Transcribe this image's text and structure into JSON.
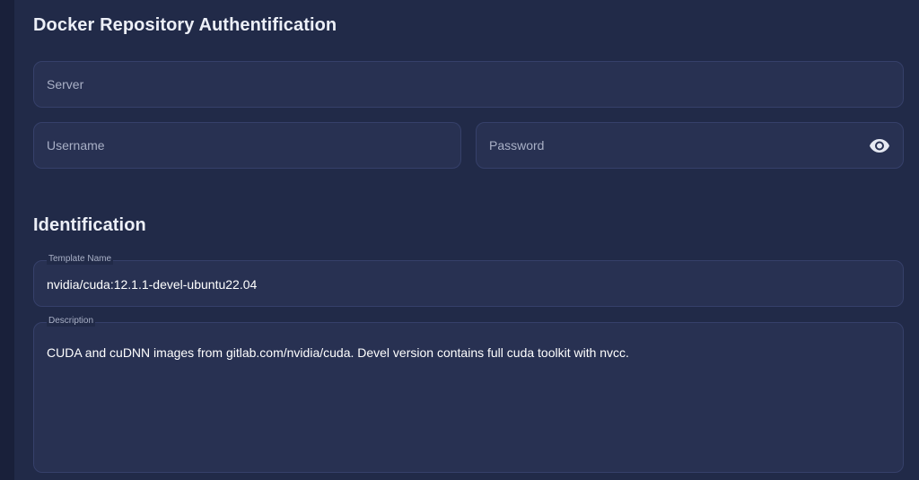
{
  "docker_auth": {
    "title": "Docker Repository Authentification",
    "server": {
      "placeholder": "Server",
      "value": ""
    },
    "username": {
      "placeholder": "Username",
      "value": ""
    },
    "password": {
      "placeholder": "Password",
      "value": "",
      "visibility_icon": "eye-icon"
    }
  },
  "identification": {
    "title": "Identification",
    "template_name": {
      "label": "Template Name",
      "value": "nvidia/cuda:12.1.1-devel-ubuntu22.04"
    },
    "description": {
      "label": "Description",
      "value": "CUDA and cuDNN images from gitlab.com/nvidia/cuda.  Devel version contains full cuda toolkit with nvcc."
    }
  },
  "colors": {
    "background": "#1e2744",
    "field_background": "#283152",
    "field_border": "#36406a",
    "placeholder_text": "#a9b0c6",
    "value_text": "#ffffff"
  }
}
